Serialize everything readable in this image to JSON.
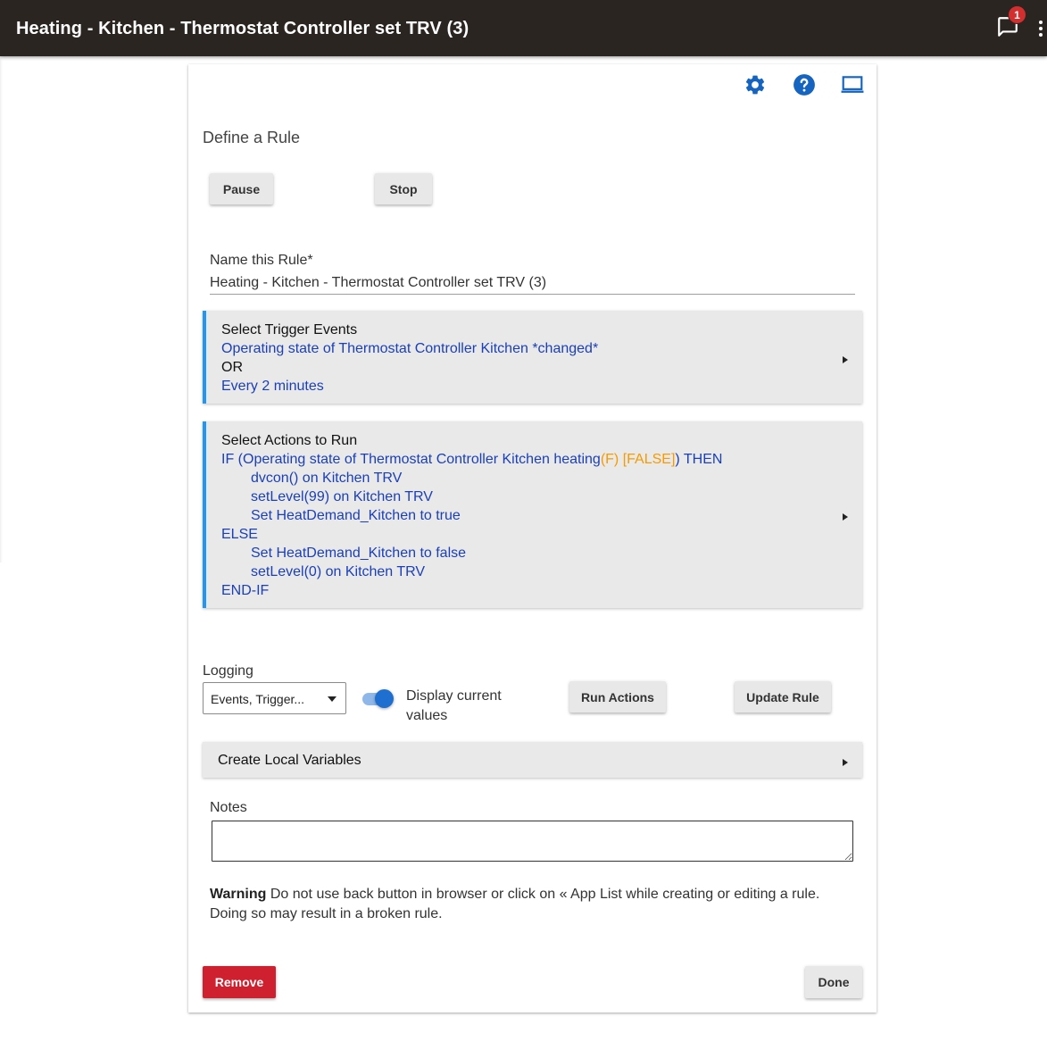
{
  "topbar": {
    "title": "Heating - Kitchen - Thermostat Controller set TRV (3)",
    "notification_count": "1",
    "icons": [
      "chat-icon",
      "more-vert-icon"
    ]
  },
  "toolbar": {
    "icons": [
      "gear-icon",
      "help-icon",
      "laptop-icon"
    ],
    "accent_color": "#1565c0"
  },
  "page": {
    "heading": "Define a Rule"
  },
  "controls": {
    "pause_label": "Pause",
    "stop_label": "Stop"
  },
  "rule_name": {
    "label": "Name this Rule*",
    "value": "Heating - Kitchen - Thermostat Controller set TRV (3)"
  },
  "triggers": {
    "header": "Select Trigger Events",
    "line1": "Operating state of Thermostat Controller Kitchen *changed*",
    "or": "OR",
    "line2": "Every 2 minutes"
  },
  "actions": {
    "header": "Select Actions to Run",
    "if_prefix": "IF (Operating state of Thermostat Controller Kitchen heating",
    "if_flag": "(F) [FALSE]",
    "if_suffix": ") THEN",
    "then_lines": [
      "dvcon() on Kitchen TRV",
      "setLevel(99) on Kitchen TRV",
      "Set HeatDemand_Kitchen to true"
    ],
    "else": "ELSE",
    "else_lines": [
      "Set HeatDemand_Kitchen to false",
      "setLevel(0) on Kitchen TRV"
    ],
    "endif": "END-IF"
  },
  "logging": {
    "label": "Logging",
    "selected": "Events, Trigger...",
    "toggle_label": "Display current values",
    "toggle_on": true
  },
  "buttons": {
    "run_actions": "Run Actions",
    "update_rule": "Update Rule",
    "remove": "Remove",
    "done": "Done"
  },
  "local_vars": {
    "header": "Create Local Variables"
  },
  "notes": {
    "label": "Notes",
    "value": ""
  },
  "warning": {
    "bold": "Warning",
    "text": " Do not use back button in browser or click on « App List while creating or editing a rule. Doing so may result in a broken rule."
  },
  "colors": {
    "accent_blue": "#2196f3",
    "link_blue": "#1a3fb8",
    "flag_orange": "#f59a00",
    "remove_red": "#cf202f",
    "topbar": "#2b2522"
  }
}
